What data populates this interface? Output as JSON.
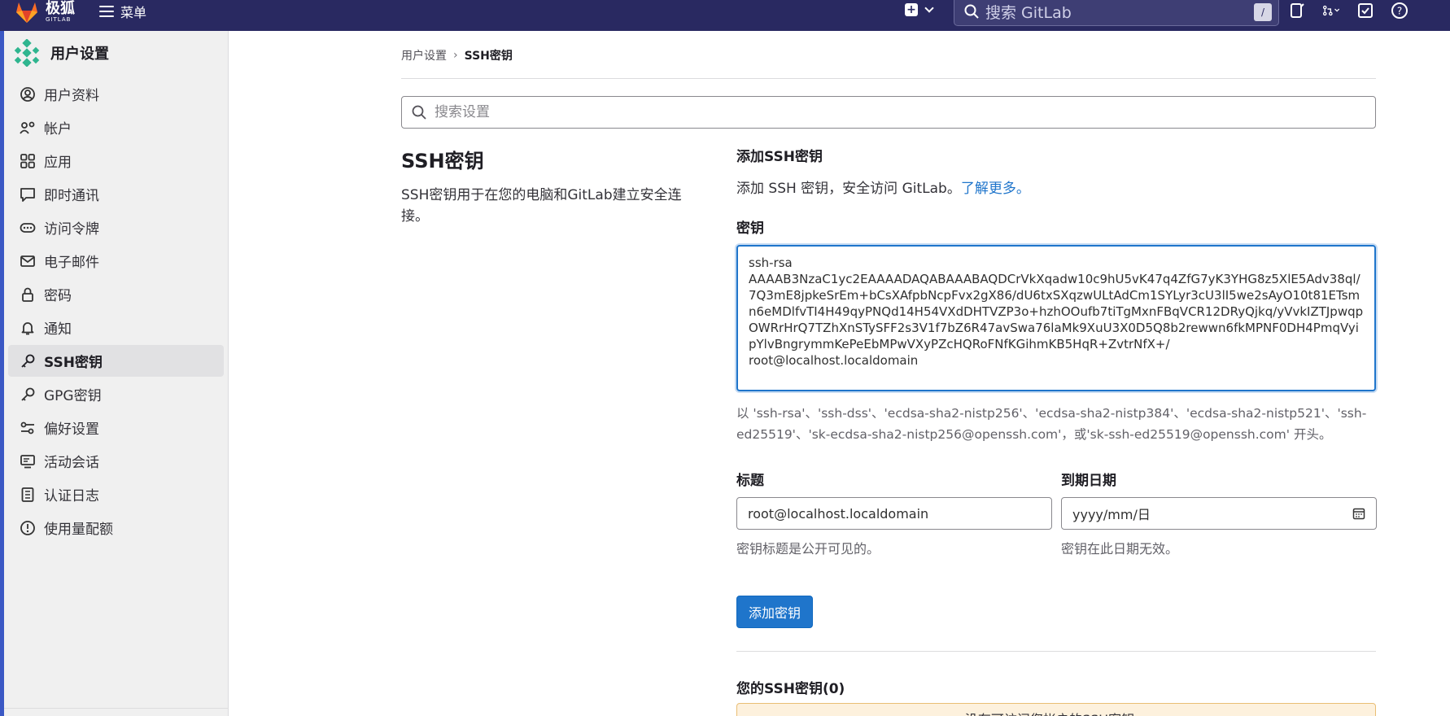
{
  "topbar": {
    "brand_name": "极狐",
    "brand_sub": "GITLAB",
    "menu_label": "菜单",
    "search_placeholder": "搜索 GitLab",
    "search_shortcut": "/"
  },
  "sidebar": {
    "title": "用户设置",
    "items": [
      {
        "label": "用户资料",
        "icon": "user-circle-icon"
      },
      {
        "label": "帐户",
        "icon": "account-gear-icon"
      },
      {
        "label": "应用",
        "icon": "grid-icon"
      },
      {
        "label": "即时通讯",
        "icon": "chat-icon"
      },
      {
        "label": "访问令牌",
        "icon": "token-icon"
      },
      {
        "label": "电子邮件",
        "icon": "mail-icon"
      },
      {
        "label": "密码",
        "icon": "lock-icon"
      },
      {
        "label": "通知",
        "icon": "bell-icon"
      },
      {
        "label": "SSH密钥",
        "icon": "key-icon",
        "active": true
      },
      {
        "label": "GPG密钥",
        "icon": "key-icon"
      },
      {
        "label": "偏好设置",
        "icon": "preferences-icon"
      },
      {
        "label": "活动会话",
        "icon": "monitor-icon"
      },
      {
        "label": "认证日志",
        "icon": "log-icon"
      },
      {
        "label": "使用量配额",
        "icon": "quota-icon"
      }
    ]
  },
  "breadcrumb": {
    "parent": "用户设置",
    "current": "SSH密钥"
  },
  "settings_search": {
    "placeholder": "搜索设置"
  },
  "section": {
    "title": "SSH密钥",
    "description": "SSH密钥用于在您的电脑和GitLab建立安全连接。"
  },
  "form": {
    "add_title": "添加SSH密钥",
    "add_desc": "添加 SSH 密钥，安全访问 GitLab。",
    "learn_more": "了解更多。",
    "key_label": "密钥",
    "key_value": "ssh-rsa\nAAAAB3NzaC1yc2EAAAADAQABAAABAQDCrVkXqadw10c9hU5vK47q4ZfG7yK3YHG8z5XlE5Adv38ql/7Q3mE8jpkeSrEm+bCsXAfpbNcpFvx2gX86/dU6txSXqzwULtAdCm1SYLyr3cU3lI5we2sAyO10t81ETsmn6eMDlfvTI4H49qyPNQd14H54VXdDHTVZP3o+hzhOOufb7tiTgMxnFBqVCR12DRyQjkq/yVvkIZTJpwqpOWRrHrQ7TZhXnSTySFF2s3V1f7bZ6R47avSwa76laMk9XuU3X0D5Q8b2rewwn6fkMPNF0DH4PmqVyipYlvBngrymmKePeEbMPwVXyPZcHQRoFNfKGihmKB5HqR+ZvtrNfX+/\nroot@localhost.localdomain",
    "key_help": "以 'ssh-rsa'、'ssh-dss'、'ecdsa-sha2-nistp256'、'ecdsa-sha2-nistp384'、'ecdsa-sha2-nistp521'、'ssh-ed25519'、'sk-ecdsa-sha2-nistp256@openssh.com'，或'sk-ssh-ed25519@openssh.com' 开头。",
    "title_label": "标题",
    "title_value": "root@localhost.localdomain",
    "title_hint": "密钥标题是公开可见的。",
    "expire_label": "到期日期",
    "expire_placeholder": "yyyy/mm/日",
    "expire_hint": "密钥在此日期无效。",
    "submit_label": "添加密钥"
  },
  "keys_list": {
    "title": "您的SSH密钥(0)",
    "empty_message": "没有可访问您帐户的SSH密钥。"
  },
  "colors": {
    "topbar": "#292961",
    "primary": "#1f75cb",
    "warning_bg": "#fdf1dd"
  }
}
